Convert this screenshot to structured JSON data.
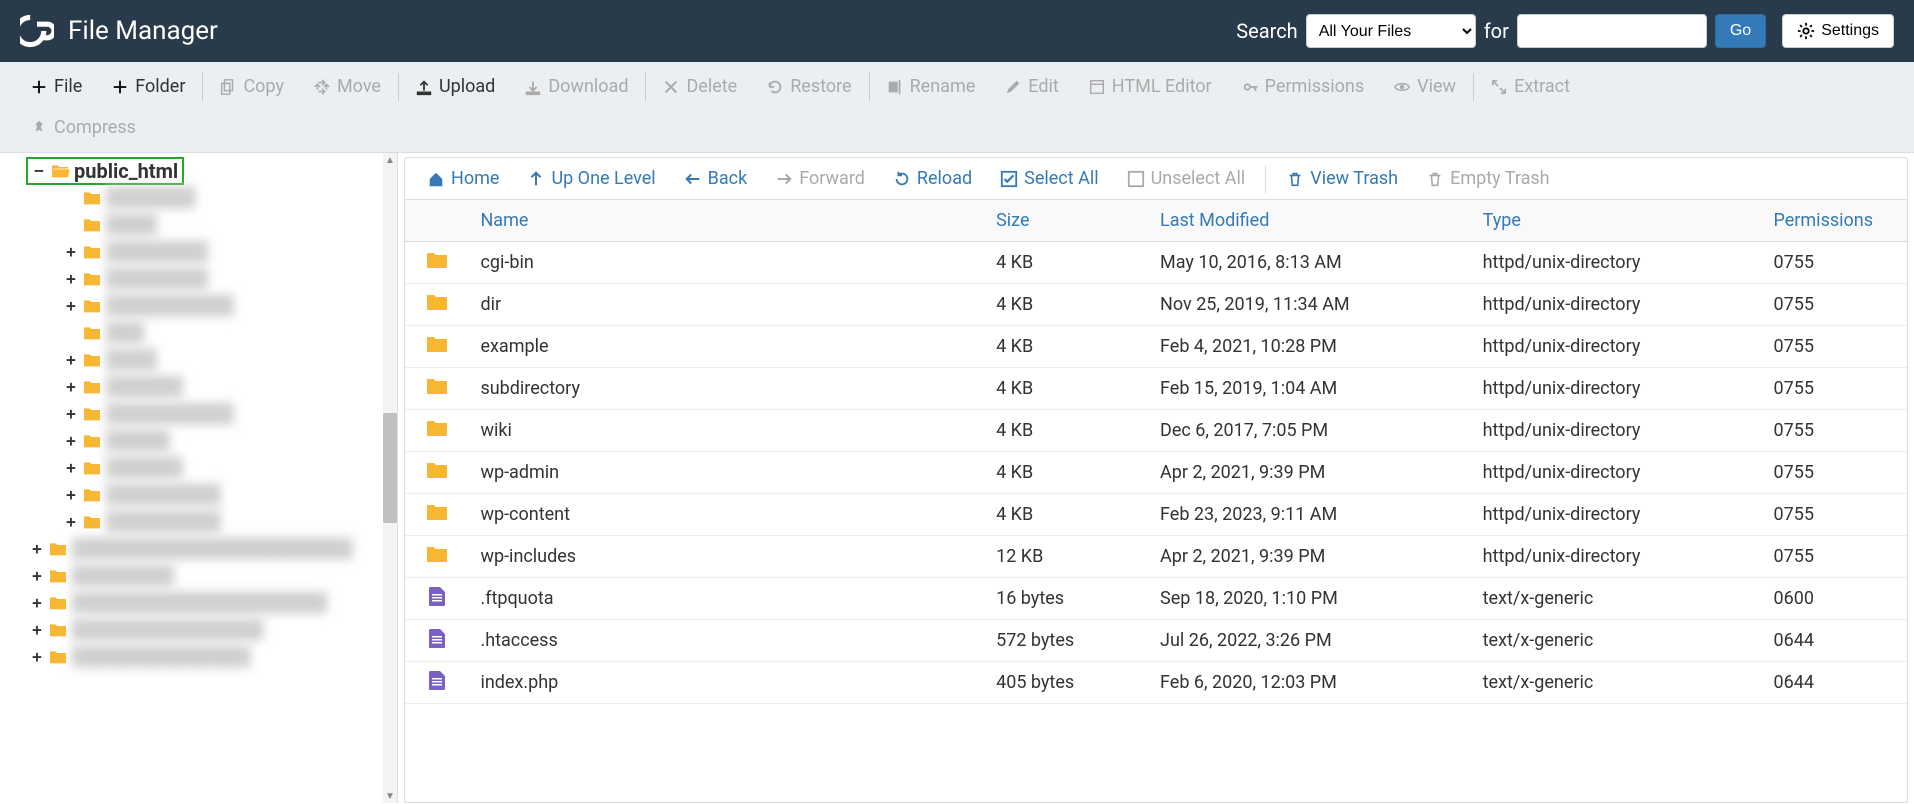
{
  "header": {
    "title": "File Manager",
    "search_label": "Search",
    "search_select": "All Your Files",
    "for_label": "for",
    "go_label": "Go",
    "settings_label": "Settings"
  },
  "toolbar": {
    "file": "File",
    "folder": "Folder",
    "copy": "Copy",
    "move": "Move",
    "upload": "Upload",
    "download": "Download",
    "delete": "Delete",
    "restore": "Restore",
    "rename": "Rename",
    "edit": "Edit",
    "html_editor": "HTML Editor",
    "permissions": "Permissions",
    "view": "View",
    "extract": "Extract",
    "compress": "Compress"
  },
  "nav": {
    "home": "Home",
    "up": "Up One Level",
    "back": "Back",
    "forward": "Forward",
    "reload": "Reload",
    "select_all": "Select All",
    "unselect_all": "Unselect All",
    "view_trash": "View Trash",
    "empty_trash": "Empty Trash"
  },
  "tree": {
    "root": "public_html",
    "children": [
      {
        "toggle": "",
        "indent": 1,
        "label": "███████",
        "blurred": true
      },
      {
        "toggle": "",
        "indent": 1,
        "label": "████",
        "blurred": true
      },
      {
        "toggle": "+",
        "indent": 1,
        "label": "████████",
        "blurred": true
      },
      {
        "toggle": "+",
        "indent": 1,
        "label": "████████",
        "blurred": true
      },
      {
        "toggle": "+",
        "indent": 1,
        "label": "██████████",
        "blurred": true
      },
      {
        "toggle": "",
        "indent": 1,
        "label": "███",
        "blurred": true
      },
      {
        "toggle": "+",
        "indent": 1,
        "label": "████",
        "blurred": true
      },
      {
        "toggle": "+",
        "indent": 1,
        "label": "██████",
        "blurred": true
      },
      {
        "toggle": "+",
        "indent": 1,
        "label": "██████████",
        "blurred": true
      },
      {
        "toggle": "+",
        "indent": 1,
        "label": "█████",
        "blurred": true
      },
      {
        "toggle": "+",
        "indent": 1,
        "label": "██████",
        "blurred": true
      },
      {
        "toggle": "+",
        "indent": 1,
        "label": "█████████",
        "blurred": true
      },
      {
        "toggle": "+",
        "indent": 1,
        "label": "█████████",
        "blurred": true
      },
      {
        "toggle": "+",
        "indent": 0,
        "label": "██████████████████████",
        "blurred": true
      },
      {
        "toggle": "+",
        "indent": 0,
        "label": "████████",
        "blurred": true
      },
      {
        "toggle": "+",
        "indent": 0,
        "label": "████████████████████",
        "blurred": true
      },
      {
        "toggle": "+",
        "indent": 0,
        "label": "███████████████",
        "blurred": true
      },
      {
        "toggle": "+",
        "indent": 0,
        "label": "██████████████",
        "blurred": true
      }
    ]
  },
  "table": {
    "headers": {
      "name": "Name",
      "size": "Size",
      "modified": "Last Modified",
      "type": "Type",
      "permissions": "Permissions"
    },
    "rows": [
      {
        "icon": "folder",
        "name": "cgi-bin",
        "size": "4 KB",
        "modified": "May 10, 2016, 8:13 AM",
        "type": "httpd/unix-directory",
        "perm": "0755"
      },
      {
        "icon": "folder",
        "name": "dir",
        "size": "4 KB",
        "modified": "Nov 25, 2019, 11:34 AM",
        "type": "httpd/unix-directory",
        "perm": "0755"
      },
      {
        "icon": "folder",
        "name": "example",
        "size": "4 KB",
        "modified": "Feb 4, 2021, 10:28 PM",
        "type": "httpd/unix-directory",
        "perm": "0755"
      },
      {
        "icon": "folder",
        "name": "subdirectory",
        "size": "4 KB",
        "modified": "Feb 15, 2019, 1:04 AM",
        "type": "httpd/unix-directory",
        "perm": "0755"
      },
      {
        "icon": "folder",
        "name": "wiki",
        "size": "4 KB",
        "modified": "Dec 6, 2017, 7:05 PM",
        "type": "httpd/unix-directory",
        "perm": "0755"
      },
      {
        "icon": "folder",
        "name": "wp-admin",
        "size": "4 KB",
        "modified": "Apr 2, 2021, 9:39 PM",
        "type": "httpd/unix-directory",
        "perm": "0755"
      },
      {
        "icon": "folder",
        "name": "wp-content",
        "size": "4 KB",
        "modified": "Feb 23, 2023, 9:11 AM",
        "type": "httpd/unix-directory",
        "perm": "0755"
      },
      {
        "icon": "folder",
        "name": "wp-includes",
        "size": "12 KB",
        "modified": "Apr 2, 2021, 9:39 PM",
        "type": "httpd/unix-directory",
        "perm": "0755"
      },
      {
        "icon": "file",
        "name": ".ftpquota",
        "size": "16 bytes",
        "modified": "Sep 18, 2020, 1:10 PM",
        "type": "text/x-generic",
        "perm": "0600"
      },
      {
        "icon": "file",
        "name": ".htaccess",
        "size": "572 bytes",
        "modified": "Jul 26, 2022, 3:26 PM",
        "type": "text/x-generic",
        "perm": "0644"
      },
      {
        "icon": "file",
        "name": "index.php",
        "size": "405 bytes",
        "modified": "Feb 6, 2020, 12:03 PM",
        "type": "text/x-generic",
        "perm": "0644"
      }
    ]
  }
}
